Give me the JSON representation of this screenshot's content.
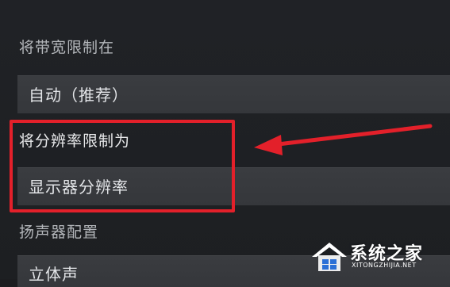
{
  "settings": {
    "bandwidth": {
      "label": "将带宽限制在",
      "value": "自动（推荐）"
    },
    "resolution": {
      "label": "将分辨率限制为",
      "value": "显示器分辨率"
    },
    "speaker": {
      "label": "扬声器配置",
      "value": "立体声"
    }
  },
  "annotation": {
    "box_color": "#e3202a",
    "arrow_color": "#e3202a"
  },
  "watermark": {
    "title": "系统之家",
    "url": "XITONGZHIJIA.NET",
    "icon": "house-logo-icon"
  }
}
